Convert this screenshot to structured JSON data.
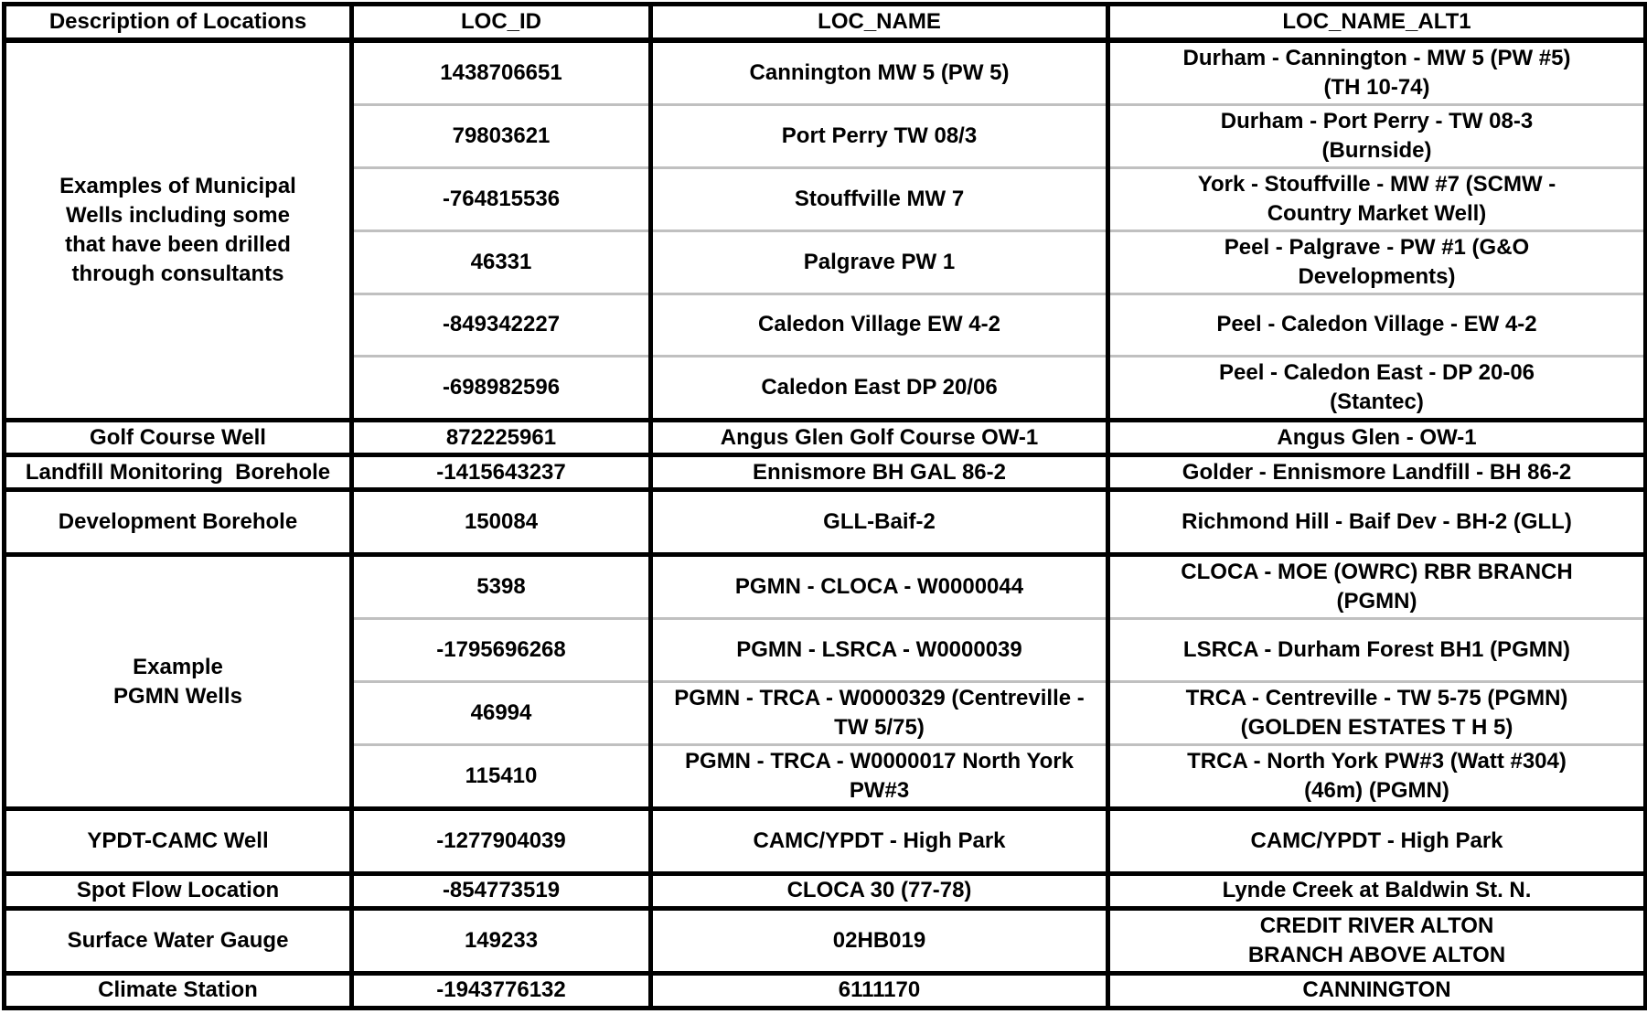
{
  "table": {
    "headers": [
      "Description of Locations",
      "LOC_ID",
      "LOC_NAME",
      "LOC_NAME_ALT1"
    ],
    "groups": [
      {
        "description": "Examples of Municipal Wells including some that have been drilled through consultants",
        "rows": [
          {
            "loc_id": "1438706651",
            "loc_name": "Cannington MW 5 (PW 5)",
            "loc_name_alt1": "Durham - Cannington - MW 5 (PW #5) (TH 10-74)"
          },
          {
            "loc_id": "79803621",
            "loc_name": "Port Perry TW 08/3",
            "loc_name_alt1": "Durham - Port Perry - TW 08-3 (Burnside)"
          },
          {
            "loc_id": "-764815536",
            "loc_name": "Stouffville MW 7",
            "loc_name_alt1": "York - Stouffville - MW #7 (SCMW - Country Market Well)"
          },
          {
            "loc_id": "46331",
            "loc_name": "Palgrave PW 1",
            "loc_name_alt1": "Peel - Palgrave - PW #1 (G&O Developments)"
          },
          {
            "loc_id": "-849342227",
            "loc_name": "Caledon Village EW 4-2",
            "loc_name_alt1": "Peel - Caledon Village - EW 4-2"
          },
          {
            "loc_id": "-698982596",
            "loc_name": "Caledon East DP 20/06",
            "loc_name_alt1": "Peel - Caledon East - DP 20-06 (Stantec)"
          }
        ]
      },
      {
        "description": "Golf Course Well",
        "rows": [
          {
            "loc_id": "872225961",
            "loc_name": "Angus Glen Golf Course OW-1",
            "loc_name_alt1": "Angus Glen - OW-1"
          }
        ]
      },
      {
        "description": "Landfill Monitoring  Borehole",
        "rows": [
          {
            "loc_id": "-1415643237",
            "loc_name": "Ennismore BH GAL 86-2",
            "loc_name_alt1": "Golder - Ennismore Landfill - BH 86-2"
          }
        ]
      },
      {
        "description": "Development Borehole",
        "rows": [
          {
            "loc_id": "150084",
            "loc_name": "GLL-Baif-2",
            "loc_name_alt1": "Richmond Hill - Baif Dev - BH-2 (GLL)"
          }
        ]
      },
      {
        "description": "Example PGMN Wells",
        "rows": [
          {
            "loc_id": "5398",
            "loc_name": "PGMN - CLOCA - W0000044",
            "loc_name_alt1": "CLOCA - MOE (OWRC) RBR BRANCH (PGMN)"
          },
          {
            "loc_id": "-1795696268",
            "loc_name": "PGMN - LSRCA - W0000039",
            "loc_name_alt1": "LSRCA - Durham Forest BH1 (PGMN)"
          },
          {
            "loc_id": "46994",
            "loc_name": "PGMN - TRCA - W0000329 (Centreville - TW 5/75)",
            "loc_name_alt1": "TRCA - Centreville - TW 5-75 (PGMN) (GOLDEN ESTATES T H 5)"
          },
          {
            "loc_id": "115410",
            "loc_name": "PGMN - TRCA - W0000017 North York PW#3",
            "loc_name_alt1": "TRCA - North York PW#3 (Watt #304) (46m) (PGMN)"
          }
        ]
      },
      {
        "description": "YPDT-CAMC Well",
        "rows": [
          {
            "loc_id": "-1277904039",
            "loc_name": "CAMC/YPDT - High Park",
            "loc_name_alt1": "CAMC/YPDT - High Park"
          }
        ]
      },
      {
        "description": "Spot Flow Location",
        "rows": [
          {
            "loc_id": "-854773519",
            "loc_name": "CLOCA 30 (77-78)",
            "loc_name_alt1": "Lynde Creek at Baldwin St. N."
          }
        ]
      },
      {
        "description": "Surface Water Gauge",
        "rows": [
          {
            "loc_id": "149233",
            "loc_name": "02HB019",
            "loc_name_alt1": "CREDIT RIVER ALTON BRANCH ABOVE ALTON"
          }
        ]
      },
      {
        "description": "Climate Station",
        "rows": [
          {
            "loc_id": "-1943776132",
            "loc_name": "6111170",
            "loc_name_alt1": "CANNINGTON"
          }
        ]
      }
    ]
  }
}
